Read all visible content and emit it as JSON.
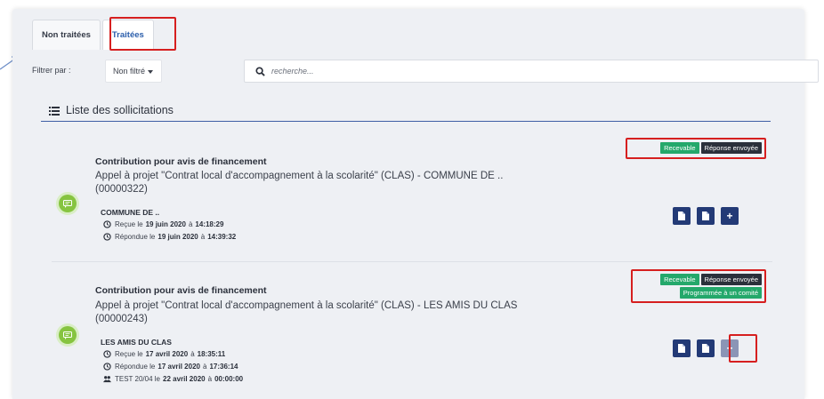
{
  "tabs": [
    {
      "label": "Non traitées",
      "active": false
    },
    {
      "label": "Traitées",
      "active": true
    }
  ],
  "filter": {
    "label": "Filtrer par :",
    "select_value": "Non filtré",
    "search_placeholder": "recherche..."
  },
  "list": {
    "title": "Liste des sollicitations",
    "items": [
      {
        "title": "Contribution pour avis de financement",
        "desc": "Appel à projet \"Contrat local d'accompagnement à la scolarité\" (CLAS) - COMMUNE DE .. (00000322)",
        "org": "COMMUNE DE ..",
        "received_prefix": "Reçue le",
        "received_date": "19 juin 2020",
        "received_at": "à",
        "received_time": "14:18:29",
        "answered_prefix": "Répondue le",
        "answered_date": "19 juin 2020",
        "answered_at": "à",
        "answered_time": "14:39:32",
        "badges": [
          "Recevable",
          "Réponse envoyée"
        ]
      },
      {
        "title": "Contribution pour avis de financement",
        "desc": "Appel à projet \"Contrat local d'accompagnement à la scolarité\" (CLAS) - LES AMIS DU CLAS (00000243)",
        "org": "LES AMIS DU CLAS",
        "received_prefix": "Reçue le",
        "received_date": "17 avril 2020",
        "received_at": "à",
        "received_time": "18:35:11",
        "answered_prefix": "Répondue le",
        "answered_date": "17 avril 2020",
        "answered_at": "à",
        "answered_time": "17:36:14",
        "committee_prefix": "TEST 20/04 le",
        "committee_date": "22 avril 2020",
        "committee_at": "à",
        "committee_time": "00:00:00",
        "badges": [
          "Recevable",
          "Réponse envoyée",
          "Programmée à un comité"
        ]
      }
    ]
  },
  "actions": {
    "add_symbol": "+"
  },
  "colors": {
    "accent": "#2b5eab",
    "badge_green": "#24a86b",
    "badge_dark": "#2b303b",
    "action_blue": "#233a76",
    "avatar_green": "#86c440",
    "highlight_red": "#d61f1f"
  },
  "icons": [
    "arrow-icon",
    "search-icon",
    "list-icon",
    "chat-icon",
    "clock-icon",
    "document-icon",
    "plus-icon",
    "group-icon"
  ]
}
